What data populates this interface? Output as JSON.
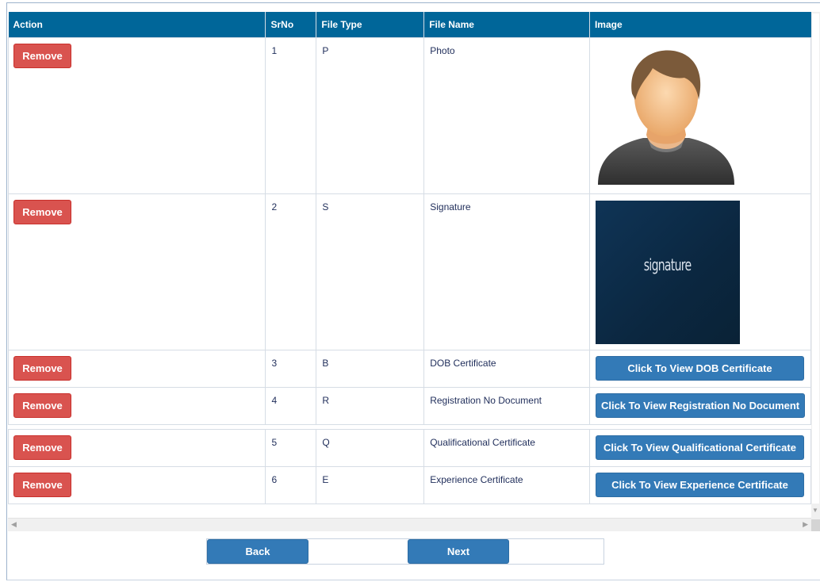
{
  "table": {
    "headers": [
      "Action",
      "SrNo",
      "File Type",
      "File Name",
      "Image"
    ],
    "rows": [
      {
        "action": "Remove",
        "srno": "1",
        "file_type": "P",
        "file_name": "Photo"
      },
      {
        "action": "Remove",
        "srno": "2",
        "file_type": "S",
        "file_name": "Signature",
        "image_text": "signature"
      },
      {
        "action": "Remove",
        "srno": "3",
        "file_type": "B",
        "file_name": "DOB Certificate",
        "view_label": "Click To View DOB Certificate"
      },
      {
        "action": "Remove",
        "srno": "4",
        "file_type": "R",
        "file_name": "Registration No Document",
        "view_label": "Click To View Registration No Document"
      },
      {
        "action": "Remove",
        "srno": "5",
        "file_type": "Q",
        "file_name": "Qualificational Certificate",
        "view_label": "Click To View Qualificational Certificate"
      },
      {
        "action": "Remove",
        "srno": "6",
        "file_type": "E",
        "file_name": "Experience Certificate",
        "view_label": "Click To View Experience Certificate"
      }
    ]
  },
  "footer": {
    "back_label": "Back",
    "next_label": "Next"
  },
  "colors": {
    "header_bg": "#006699",
    "remove_bg": "#d9534f",
    "primary_bg": "#337ab7"
  },
  "icons": {
    "photo": "person-avatar-icon"
  }
}
